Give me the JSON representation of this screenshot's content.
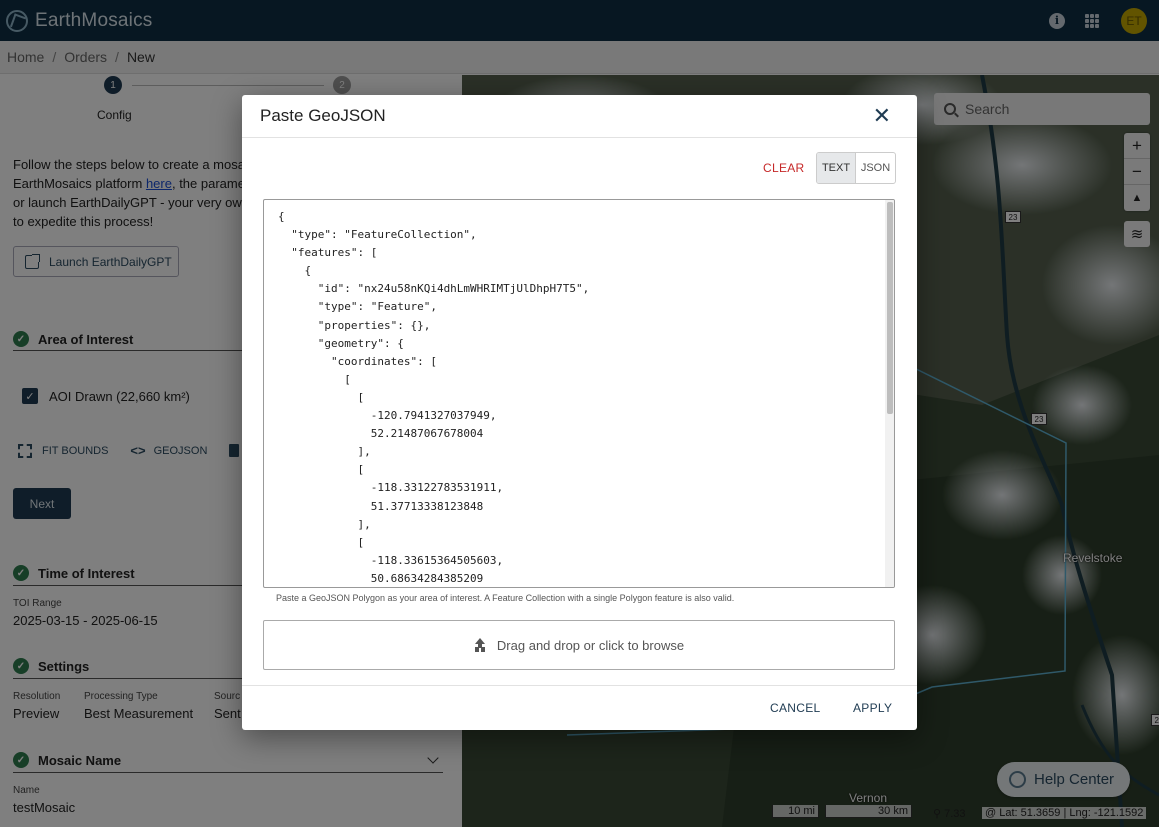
{
  "app": {
    "name": "EarthMosaics",
    "avatar_initials": "ET"
  },
  "breadcrumb": [
    "Home",
    "Orders",
    "New"
  ],
  "stepper": {
    "steps": [
      {
        "number": "1",
        "label": "Config"
      },
      {
        "number": "2",
        "label": ""
      }
    ]
  },
  "intro": {
    "text_before_link": "Follow the steps below to create a mosa",
    "line2": "EarthMosaics platform ",
    "link": "here",
    "line2_after": ", the parame",
    "line3": "or launch EarthDailyGPT - your very ow",
    "line4": "to expedite this process!"
  },
  "launch_button": "Launch EarthDailyGPT",
  "aoi": {
    "title": "Area of Interest",
    "item": "AOI Drawn (22,660 km²)",
    "fit_bounds": "FIT BOUNDS",
    "geojson": "GEOJSON",
    "next": "Next"
  },
  "toi": {
    "title": "Time of Interest",
    "range_label": "TOI Range",
    "range_value": "2025-03-15 - 2025-06-15"
  },
  "settings": {
    "title": "Settings",
    "fields": [
      {
        "label": "Resolution",
        "value": "Preview"
      },
      {
        "label": "Processing Type",
        "value": "Best Measurement"
      },
      {
        "label": "Sourc",
        "value": "Sent"
      }
    ]
  },
  "mosaic_name": {
    "title": "Mosaic Name",
    "label": "Name",
    "value": "testMosaic"
  },
  "map": {
    "search_placeholder": "Search",
    "zoom_in": "+",
    "zoom_out": "−",
    "reset": "▲",
    "towns": [
      "Revelstoke",
      "Vernon"
    ],
    "road_numbers": [
      "23",
      "23",
      "23"
    ],
    "help": "Help Center",
    "scale_mi": "10 mi",
    "scale_km": "30 km",
    "zoom_level": "⚲ 7.33",
    "coords": "@ Lat: 51.3659 | Lng: -121.1592"
  },
  "dialog": {
    "title": "Paste GeoJSON",
    "clear": "CLEAR",
    "toggle": [
      "TEXT",
      "JSON"
    ],
    "code": "{\n  \"type\": \"FeatureCollection\",\n  \"features\": [\n    {\n      \"id\": \"nx24u58nKQi4dhLmWHRIMTjUlDhpH7T5\",\n      \"type\": \"Feature\",\n      \"properties\": {},\n      \"geometry\": {\n        \"coordinates\": [\n          [\n            [\n              -120.7941327037949,\n              52.21487067678004\n            ],\n            [\n              -118.33122783531911,\n              51.37713338123848\n            ],\n            [\n              -118.33615364505603,\n              50.68634284385209",
    "hint": "Paste a GeoJSON Polygon as your area of interest. A Feature Collection with a single Polygon feature is also valid.",
    "dropzone": "Drag and drop or click to browse",
    "cancel": "CANCEL",
    "apply": "APPLY"
  }
}
